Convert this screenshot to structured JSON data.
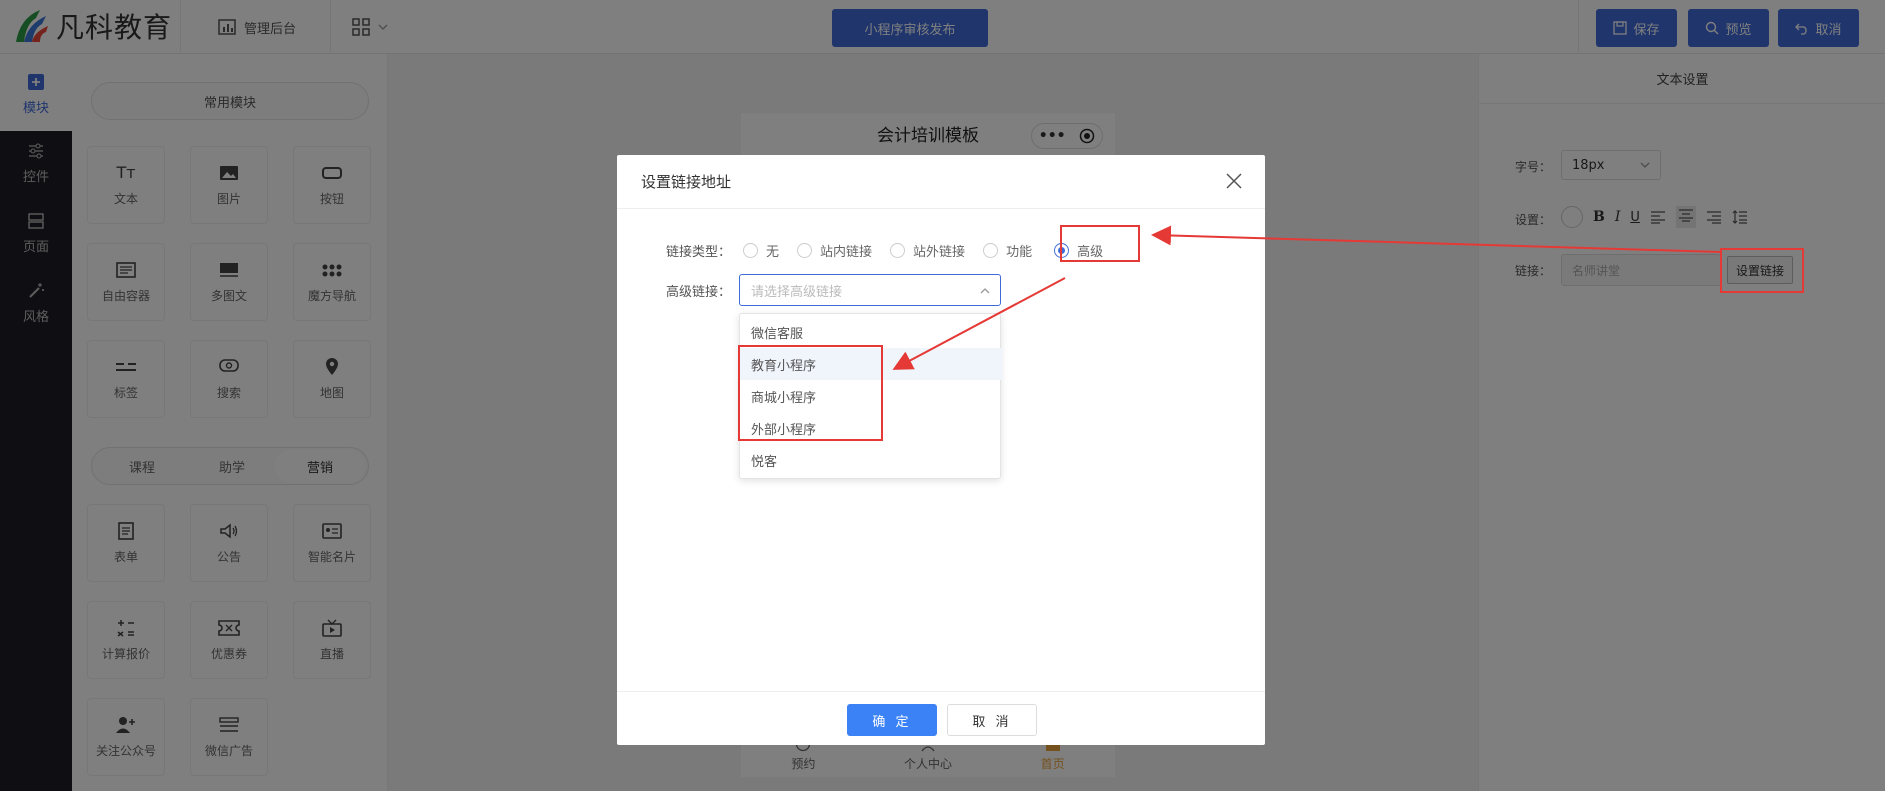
{
  "app": {
    "logo_text": "凡科教育",
    "admin_label": "管理后台",
    "publish_button": "小程序审核发布",
    "save_button": "保存",
    "preview_button": "预览",
    "cancel_button": "取消"
  },
  "leftnav": [
    {
      "label": "模块",
      "icon": "plus-square-icon",
      "active": true
    },
    {
      "label": "控件",
      "icon": "sliders-icon"
    },
    {
      "label": "页面",
      "icon": "pages-icon"
    },
    {
      "label": "风格",
      "icon": "magic-wand-icon"
    }
  ],
  "panel": {
    "common_modules": "常用模块",
    "tiles_top": [
      {
        "label": "文本",
        "icon": "text-icon"
      },
      {
        "label": "图片",
        "icon": "image-icon"
      },
      {
        "label": "按钮",
        "icon": "button-icon"
      },
      {
        "label": "自由容器",
        "icon": "container-icon"
      },
      {
        "label": "多图文",
        "icon": "multi-image-icon"
      },
      {
        "label": "魔方导航",
        "icon": "grid-dots-icon"
      },
      {
        "label": "标签",
        "icon": "tag-icon"
      },
      {
        "label": "搜索",
        "icon": "search-icon"
      },
      {
        "label": "地图",
        "icon": "map-pin-icon"
      }
    ],
    "tabs": [
      "课程",
      "助学",
      "营销"
    ],
    "tiles_bottom": [
      {
        "label": "表单",
        "icon": "form-icon"
      },
      {
        "label": "公告",
        "icon": "speaker-icon"
      },
      {
        "label": "智能名片",
        "icon": "card-icon"
      },
      {
        "label": "计算报价",
        "icon": "calculator-icon"
      },
      {
        "label": "优惠券",
        "icon": "coupon-icon"
      },
      {
        "label": "直播",
        "icon": "tv-icon"
      },
      {
        "label": "关注公众号",
        "icon": "user-plus-icon"
      },
      {
        "label": "微信广告",
        "icon": "ad-icon"
      }
    ]
  },
  "phone": {
    "title": "会计培训模板",
    "tabbar": [
      "预约",
      "个人中心",
      "首页"
    ]
  },
  "rightpanel": {
    "title": "文本设置",
    "font_size_label": "字号：",
    "font_size_value": "18px",
    "settings_label": "设置：",
    "link_label": "链接：",
    "link_value": "名师讲堂",
    "set_link_button": "设置链接"
  },
  "modal": {
    "title": "设置链接地址",
    "link_type_label": "链接类型：",
    "link_types": [
      "无",
      "站内链接",
      "站外链接",
      "功能",
      "高级"
    ],
    "selected_type": "高级",
    "advanced_label": "高级链接：",
    "advanced_placeholder": "请选择高级链接",
    "options": [
      "微信客服",
      "教育小程序",
      "商城小程序",
      "外部小程序",
      "悦客"
    ],
    "confirm": "确 定",
    "cancel": "取 消"
  },
  "colors": {
    "accent": "#3f6bd9",
    "annotation": "#e53935"
  }
}
